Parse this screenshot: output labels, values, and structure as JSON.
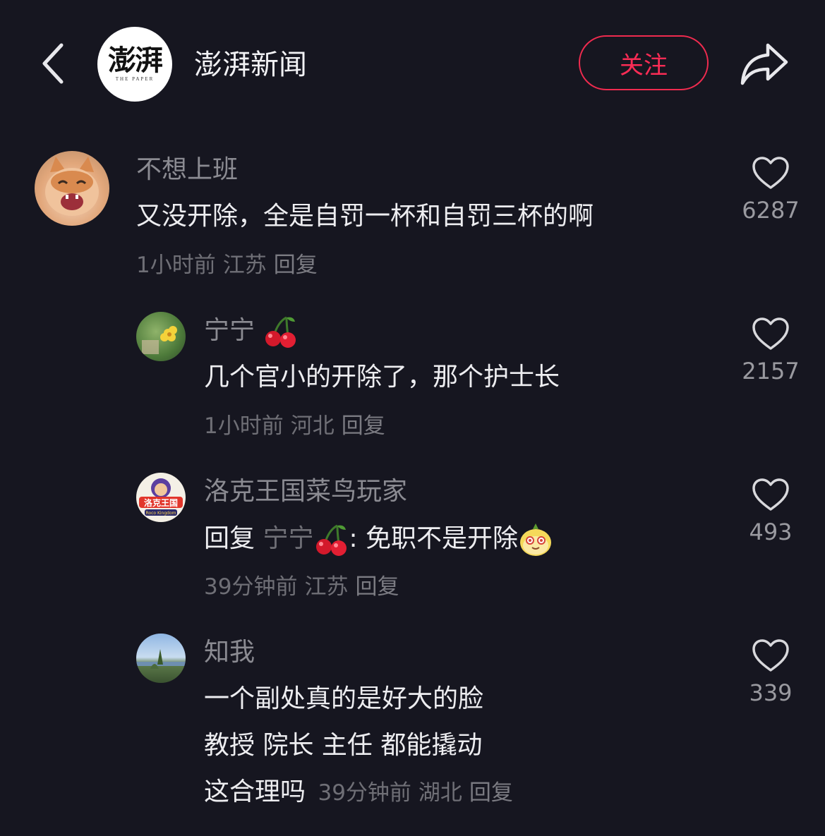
{
  "header": {
    "logo_text": "澎湃",
    "logo_sub": "THE PAPER",
    "channel_name": "澎湃新闻",
    "follow_label": "关注"
  },
  "comments": [
    {
      "username": "不想上班",
      "text": "又没开除，全是自罚一杯和自罚三杯的啊",
      "time": "1小时前",
      "location": "江苏",
      "reply_label": "回复",
      "likes": "6287"
    },
    {
      "username": "宁宁",
      "text": "几个官小的开除了，那个护士长",
      "time": "1小时前",
      "location": "河北",
      "reply_label": "回复",
      "likes": "2157"
    },
    {
      "username": "洛克王国菜鸟玩家",
      "reply_prefix": "回复",
      "reply_to": "宁宁",
      "text": ": 免职不是开除",
      "time": "39分钟前",
      "location": "江苏",
      "reply_label": "回复",
      "likes": "493",
      "avatar_text": "洛克王国",
      "avatar_sub": "Roco Kingdom"
    },
    {
      "username": "知我",
      "lines": [
        "一个副处真的是好大的脸",
        "教授 院长 主任 都能撬动",
        "这合理吗"
      ],
      "time": "39分钟前",
      "location": "湖北",
      "reply_label": "回复",
      "likes": "339"
    }
  ],
  "colors": {
    "background": "#161620",
    "accent": "#fb2c55",
    "muted": "#8b8b92"
  },
  "icons": {
    "back": "chevron-left-icon",
    "share": "share-arrow-icon",
    "like": "heart-outline-icon",
    "cherry": "cherry-emoji",
    "face": "face-emoji"
  }
}
